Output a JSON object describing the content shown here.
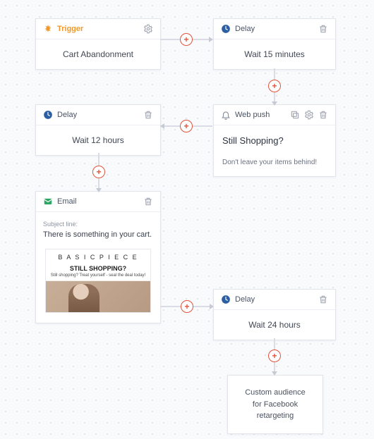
{
  "nodes": {
    "trigger": {
      "type_label": "Trigger",
      "body": "Cart Abandonment"
    },
    "delay1": {
      "type_label": "Delay",
      "body": "Wait 15 minutes"
    },
    "delay2": {
      "type_label": "Delay",
      "body": "Wait 12 hours"
    },
    "webpush": {
      "type_label": "Web push",
      "title": "Still Shopping?",
      "desc": "Don't leave your items behind!"
    },
    "email": {
      "type_label": "Email",
      "subject_label": "Subject line:",
      "subject": "There is something in your cart.",
      "preview": {
        "brand": "B A S I C  P I E C E",
        "headline": "STILL SHOPPING?",
        "sub": "Still shopping? Treat yourself - seal the deal today!"
      }
    },
    "delay3": {
      "type_label": "Delay",
      "body": "Wait 24 hours"
    },
    "audience": {
      "line1": "Custom audience",
      "line2": "for Facebook retargeting"
    }
  },
  "icons": {
    "trigger": "spark-icon",
    "delay": "clock-icon",
    "webpush": "bell-icon",
    "email": "mail-icon",
    "settings": "gear-icon",
    "delete": "trash-icon",
    "duplicate": "copy-icon",
    "add": "plus-icon"
  },
  "colors": {
    "accent_add": "#e0533d",
    "delay_icon": "#2b5ea3",
    "trigger_icon": "#f0992a",
    "email_icon": "#2fa565"
  }
}
